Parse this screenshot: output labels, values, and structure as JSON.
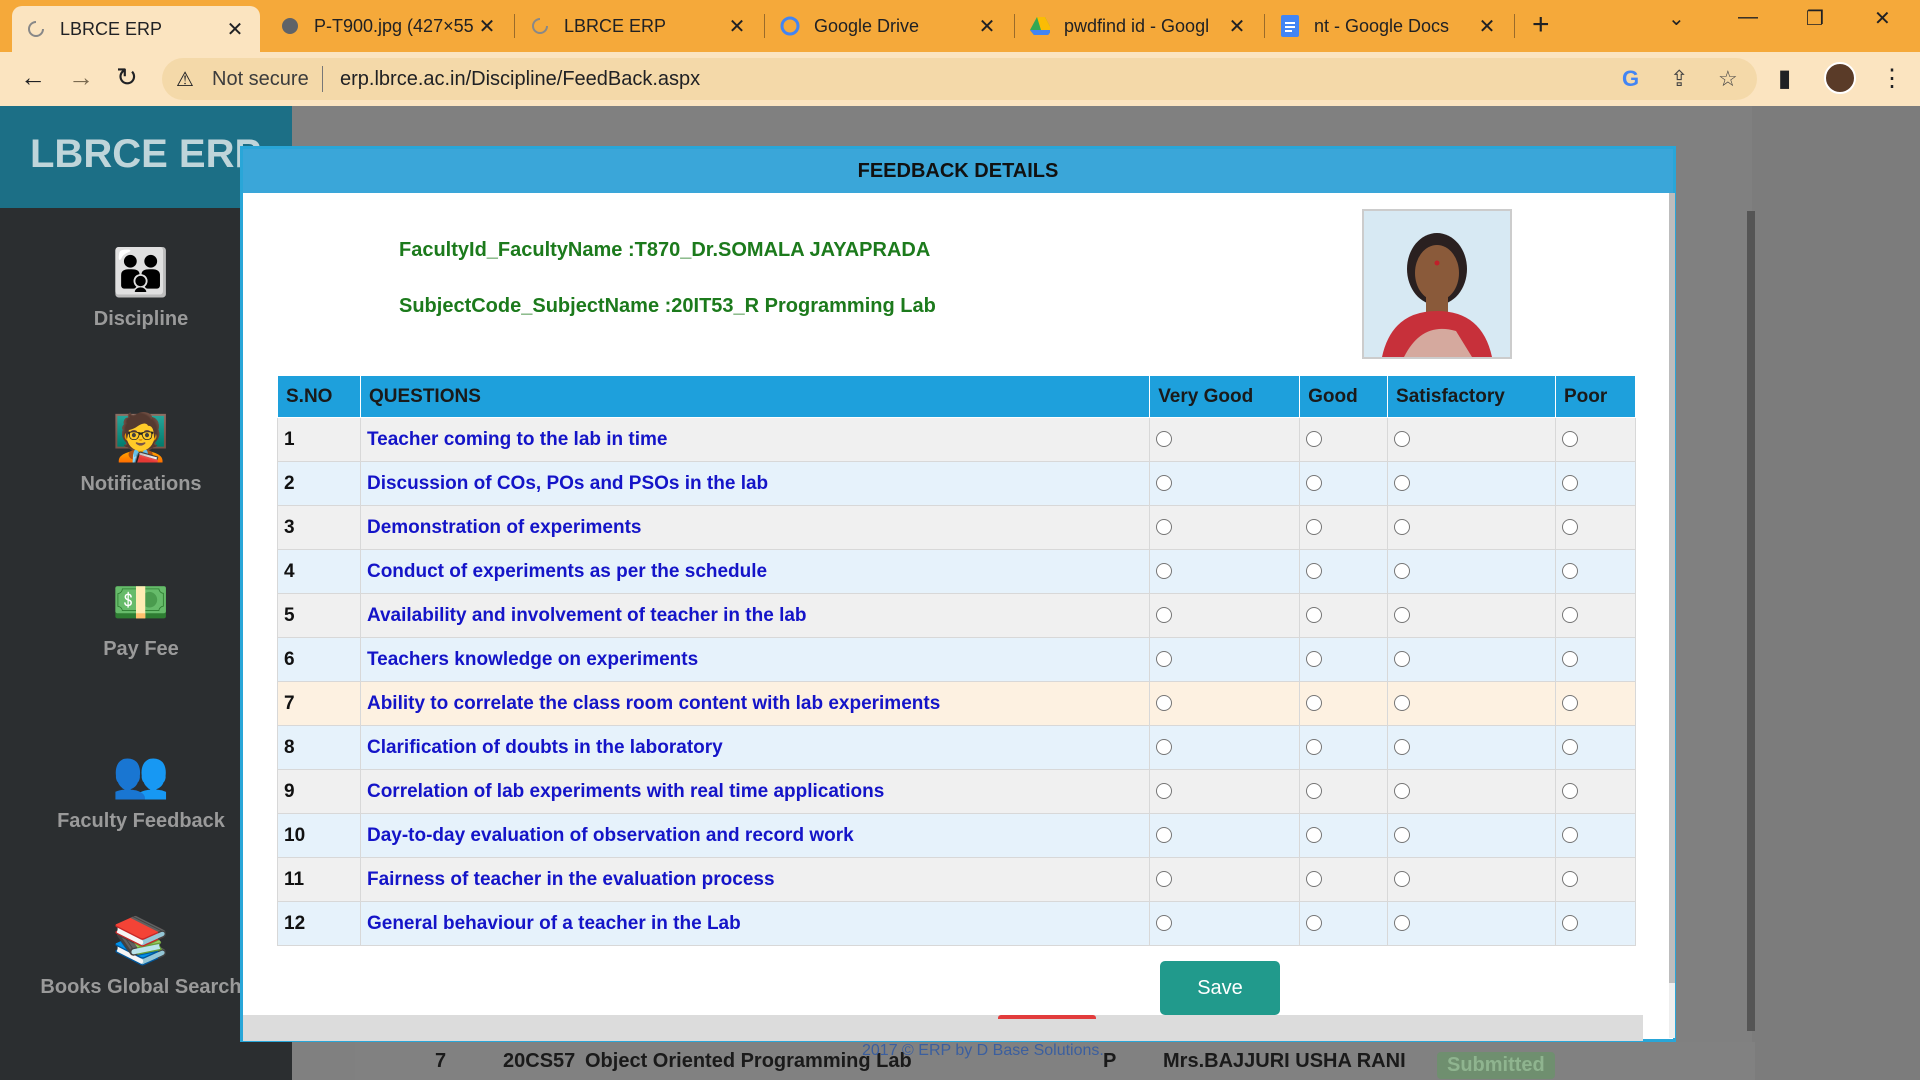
{
  "browser": {
    "tabs": [
      {
        "title": "LBRCE ERP",
        "icon": "loading-icon"
      },
      {
        "title": "P-T900.jpg (427×55",
        "icon": "globe-icon"
      },
      {
        "title": "LBRCE ERP",
        "icon": "loading-icon"
      },
      {
        "title": "Google Drive",
        "icon": "google-icon"
      },
      {
        "title": "pwdfind id - Googl",
        "icon": "drive-icon"
      },
      {
        "title": "nt - Google Docs",
        "icon": "docs-icon"
      }
    ],
    "address": {
      "security": "Not secure",
      "url": "erp.lbrce.ac.in/Discipline/FeedBack.aspx"
    }
  },
  "sidebar": {
    "brand": "LBRCE ERP",
    "items": [
      {
        "label": "Discipline",
        "icon": "discipline-icon"
      },
      {
        "label": "Notifications",
        "icon": "notifications-icon"
      },
      {
        "label": "Pay Fee",
        "icon": "pay-fee-icon"
      },
      {
        "label": "Faculty Feedback",
        "icon": "faculty-feedback-icon"
      },
      {
        "label": "Books Global Search",
        "icon": "books-icon"
      }
    ]
  },
  "background_row": {
    "sno": "7",
    "code": "20CS57",
    "subject": "Object Oriented Programming Lab",
    "type": "P",
    "faculty": "Mrs.BAJJURI USHA RANI",
    "status": "Submitted"
  },
  "footer": "2017 © ERP by D Base Solutions.",
  "modal": {
    "title": "FEEDBACK DETAILS",
    "faculty": "FacultyId_FacultyName :T870_Dr.SOMALA JAYAPRADA",
    "subject": "SubjectCode_SubjectName :20IT53_R Programming Lab",
    "columns": [
      "S.NO",
      "QUESTIONS",
      "Very Good",
      "Good",
      "Satisfactory",
      "Poor"
    ],
    "questions": [
      {
        "sno": "1",
        "text": "Teacher coming to the lab in time"
      },
      {
        "sno": "2",
        "text": "Discussion of COs, POs and PSOs in the lab"
      },
      {
        "sno": "3",
        "text": "Demonstration of experiments"
      },
      {
        "sno": "4",
        "text": "Conduct of experiments as per the schedule"
      },
      {
        "sno": "5",
        "text": "Availability and involvement of teacher in the lab"
      },
      {
        "sno": "6",
        "text": "Teachers knowledge on experiments"
      },
      {
        "sno": "7",
        "text": "Ability to correlate the class room content with lab experiments"
      },
      {
        "sno": "8",
        "text": "Clarification of doubts in the laboratory"
      },
      {
        "sno": "9",
        "text": "Correlation of lab experiments with real time applications"
      },
      {
        "sno": "10",
        "text": "Day-to-day evaluation of observation and record work"
      },
      {
        "sno": "11",
        "text": "Fairness of teacher in the evaluation process"
      },
      {
        "sno": "12",
        "text": "General behaviour of a teacher in the Lab"
      }
    ],
    "save_label": "Save"
  }
}
